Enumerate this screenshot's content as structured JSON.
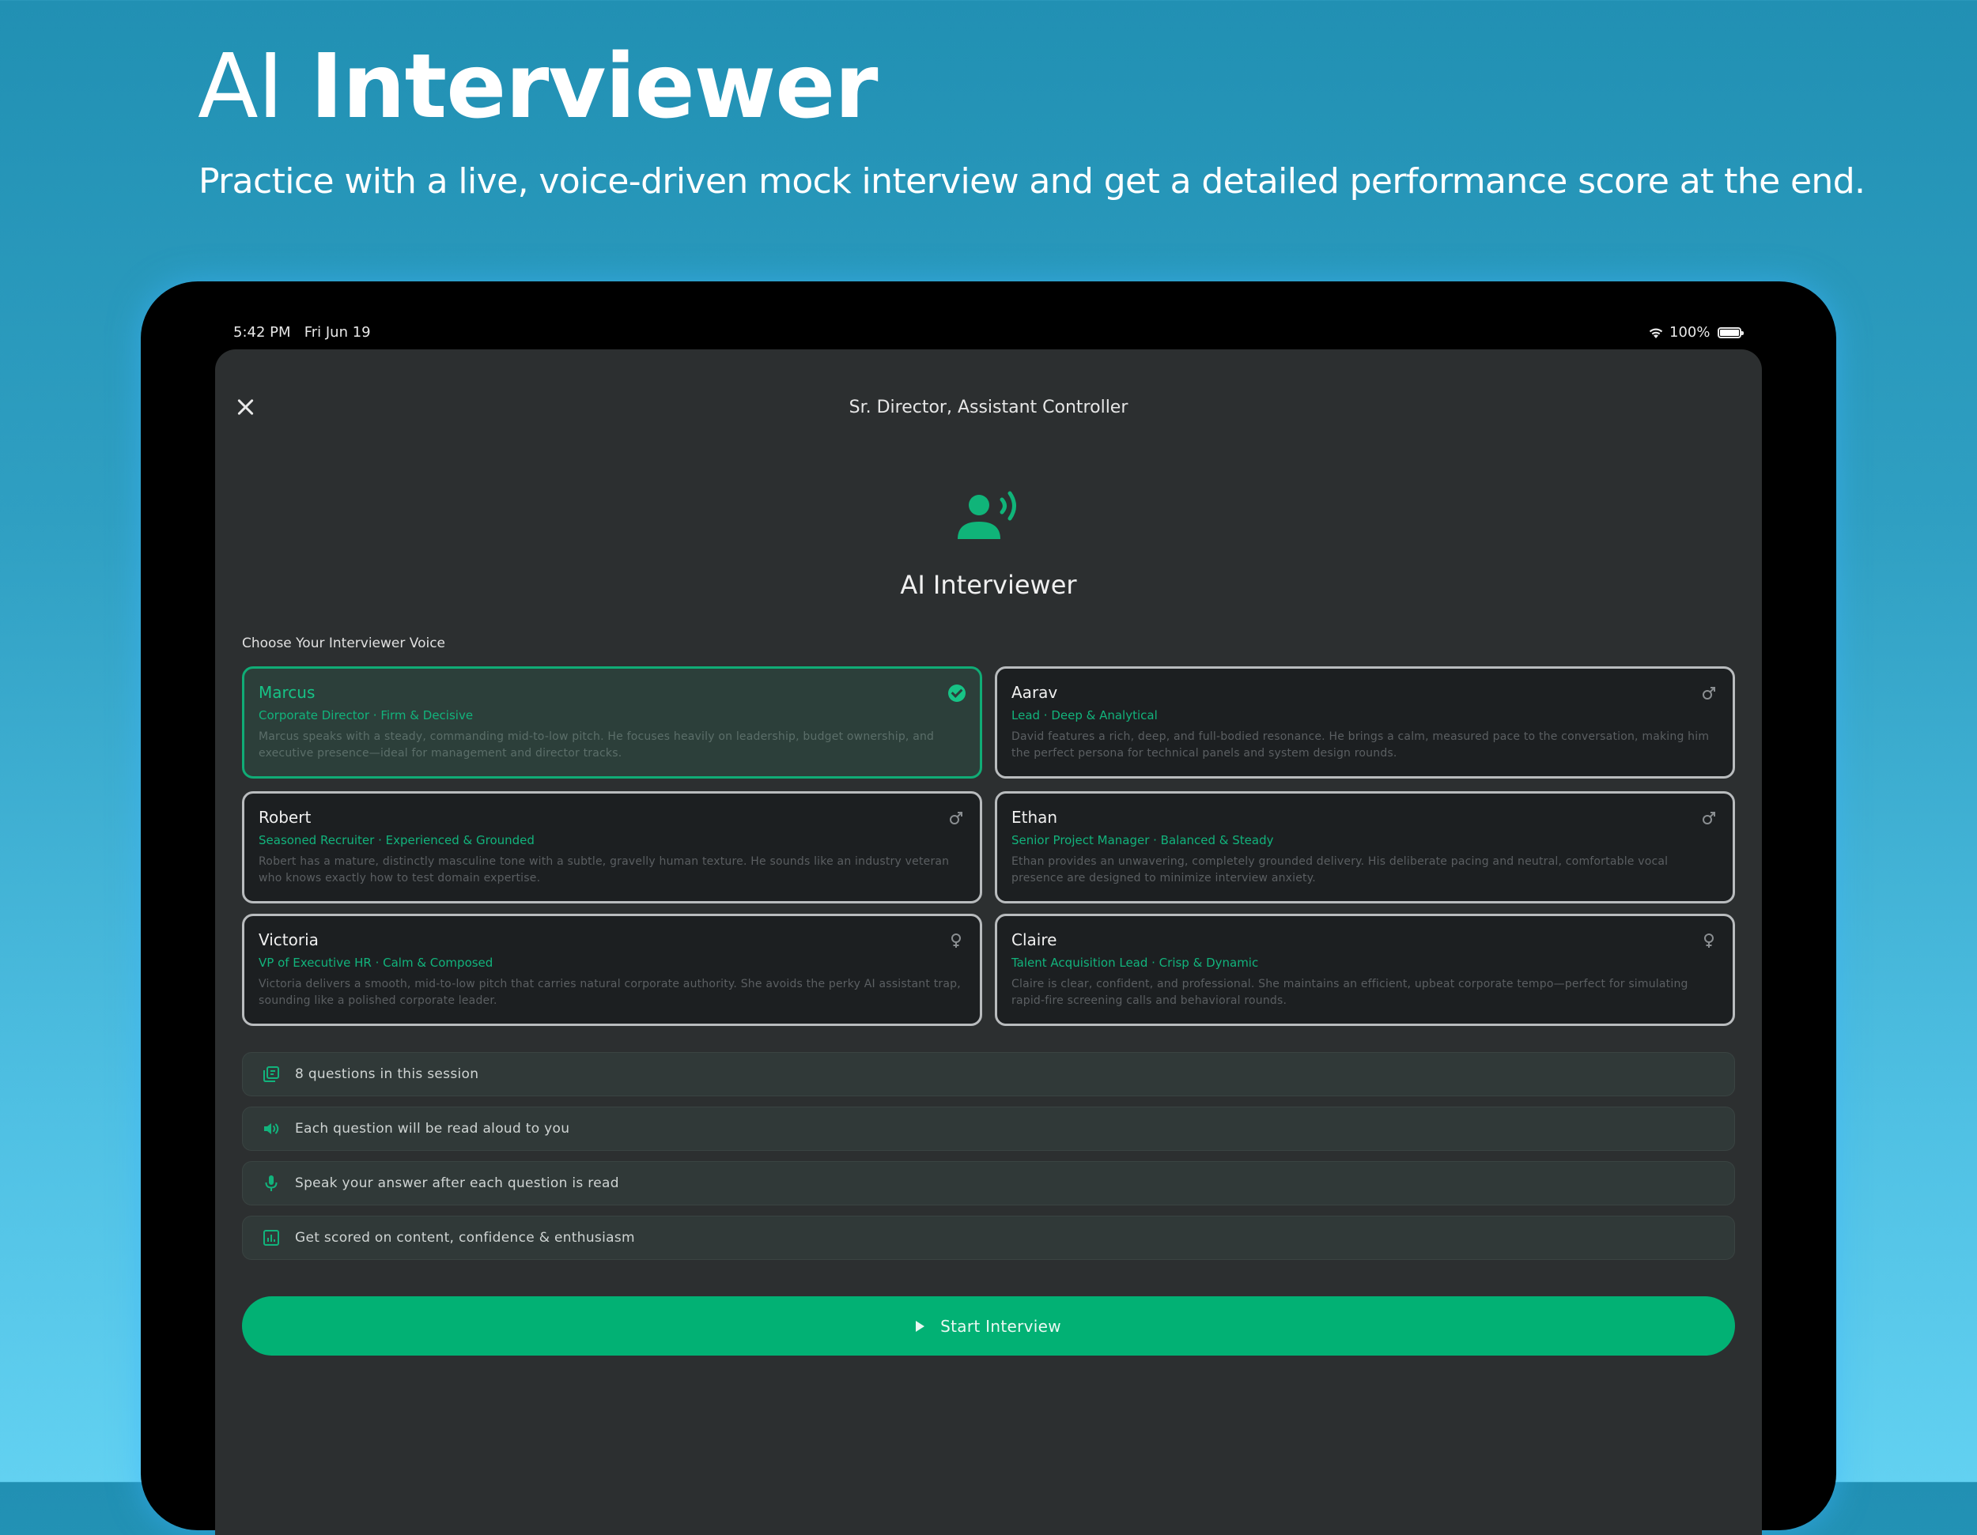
{
  "hero": {
    "title_light": "AI",
    "title_bold": "Interviewer",
    "subtitle": "Practice with a live, voice-driven mock interview and get a detailed performance score at the end."
  },
  "status_bar": {
    "time": "5:42 PM",
    "date": "Fri Jun 19",
    "battery": "100%",
    "icons": [
      "wifi-icon",
      "battery-icon"
    ]
  },
  "sheet": {
    "title": "Sr. Director, Assistant Controller",
    "panel_title": "AI Interviewer",
    "panel_icon": "speaking-person-icon",
    "choose_label": "Choose Your Interviewer Voice"
  },
  "voices": [
    {
      "name": "Marcus",
      "role": "Corporate Director · Firm & Decisive",
      "description": "Marcus speaks with a steady, commanding mid-to-low pitch. He focuses heavily on leadership, budget ownership, and executive presence—ideal for management and director tracks.",
      "gender": "male",
      "selected": true
    },
    {
      "name": "Aarav",
      "role": "Lead · Deep & Analytical",
      "description": "David features a rich, deep, and full-bodied resonance. He brings a calm, measured pace to the conversation, making him the perfect persona for technical panels and system design rounds.",
      "gender": "male",
      "selected": false
    },
    {
      "name": "Robert",
      "role": "Seasoned Recruiter · Experienced & Grounded",
      "description": "Robert has a mature, distinctly masculine tone with a subtle, gravelly human texture. He sounds like an industry veteran who knows exactly how to test domain expertise.",
      "gender": "male",
      "selected": false
    },
    {
      "name": "Ethan",
      "role": "Senior Project Manager · Balanced & Steady",
      "description": "Ethan provides an unwavering, completely grounded delivery. His deliberate pacing and neutral, comfortable vocal presence are designed to minimize interview anxiety.",
      "gender": "male",
      "selected": false
    },
    {
      "name": "Victoria",
      "role": "VP of Executive HR · Calm & Composed",
      "description": "Victoria delivers a smooth, mid-to-low pitch that carries natural corporate authority. She avoids the perky AI assistant trap, sounding like a polished corporate leader.",
      "gender": "female",
      "selected": false
    },
    {
      "name": "Claire",
      "role": "Talent Acquisition Lead · Crisp & Dynamic",
      "description": "Claire is clear, confident, and professional. She maintains an efficient, upbeat corporate tempo—perfect for simulating rapid-fire screening calls and behavioral rounds.",
      "gender": "female",
      "selected": false
    }
  ],
  "info_rows": [
    {
      "icon": "question-stack-icon",
      "text": "8 questions in this session"
    },
    {
      "icon": "speaker-icon",
      "text": "Each question will be read aloud to you"
    },
    {
      "icon": "microphone-icon",
      "text": "Speak your answer after each question is read"
    },
    {
      "icon": "score-chart-icon",
      "text": "Get scored on content, confidence & enthusiasm"
    }
  ],
  "start_button": {
    "label": "Start Interview",
    "icon": "play-icon"
  },
  "colors": {
    "accent": "#02b174",
    "accent_text": "#12b37c",
    "sheet_bg": "#2c2f30",
    "card_bg": "#1c1f21",
    "card_border": "#b9bcbe",
    "selected_card_bg": "#2c3f3a"
  }
}
